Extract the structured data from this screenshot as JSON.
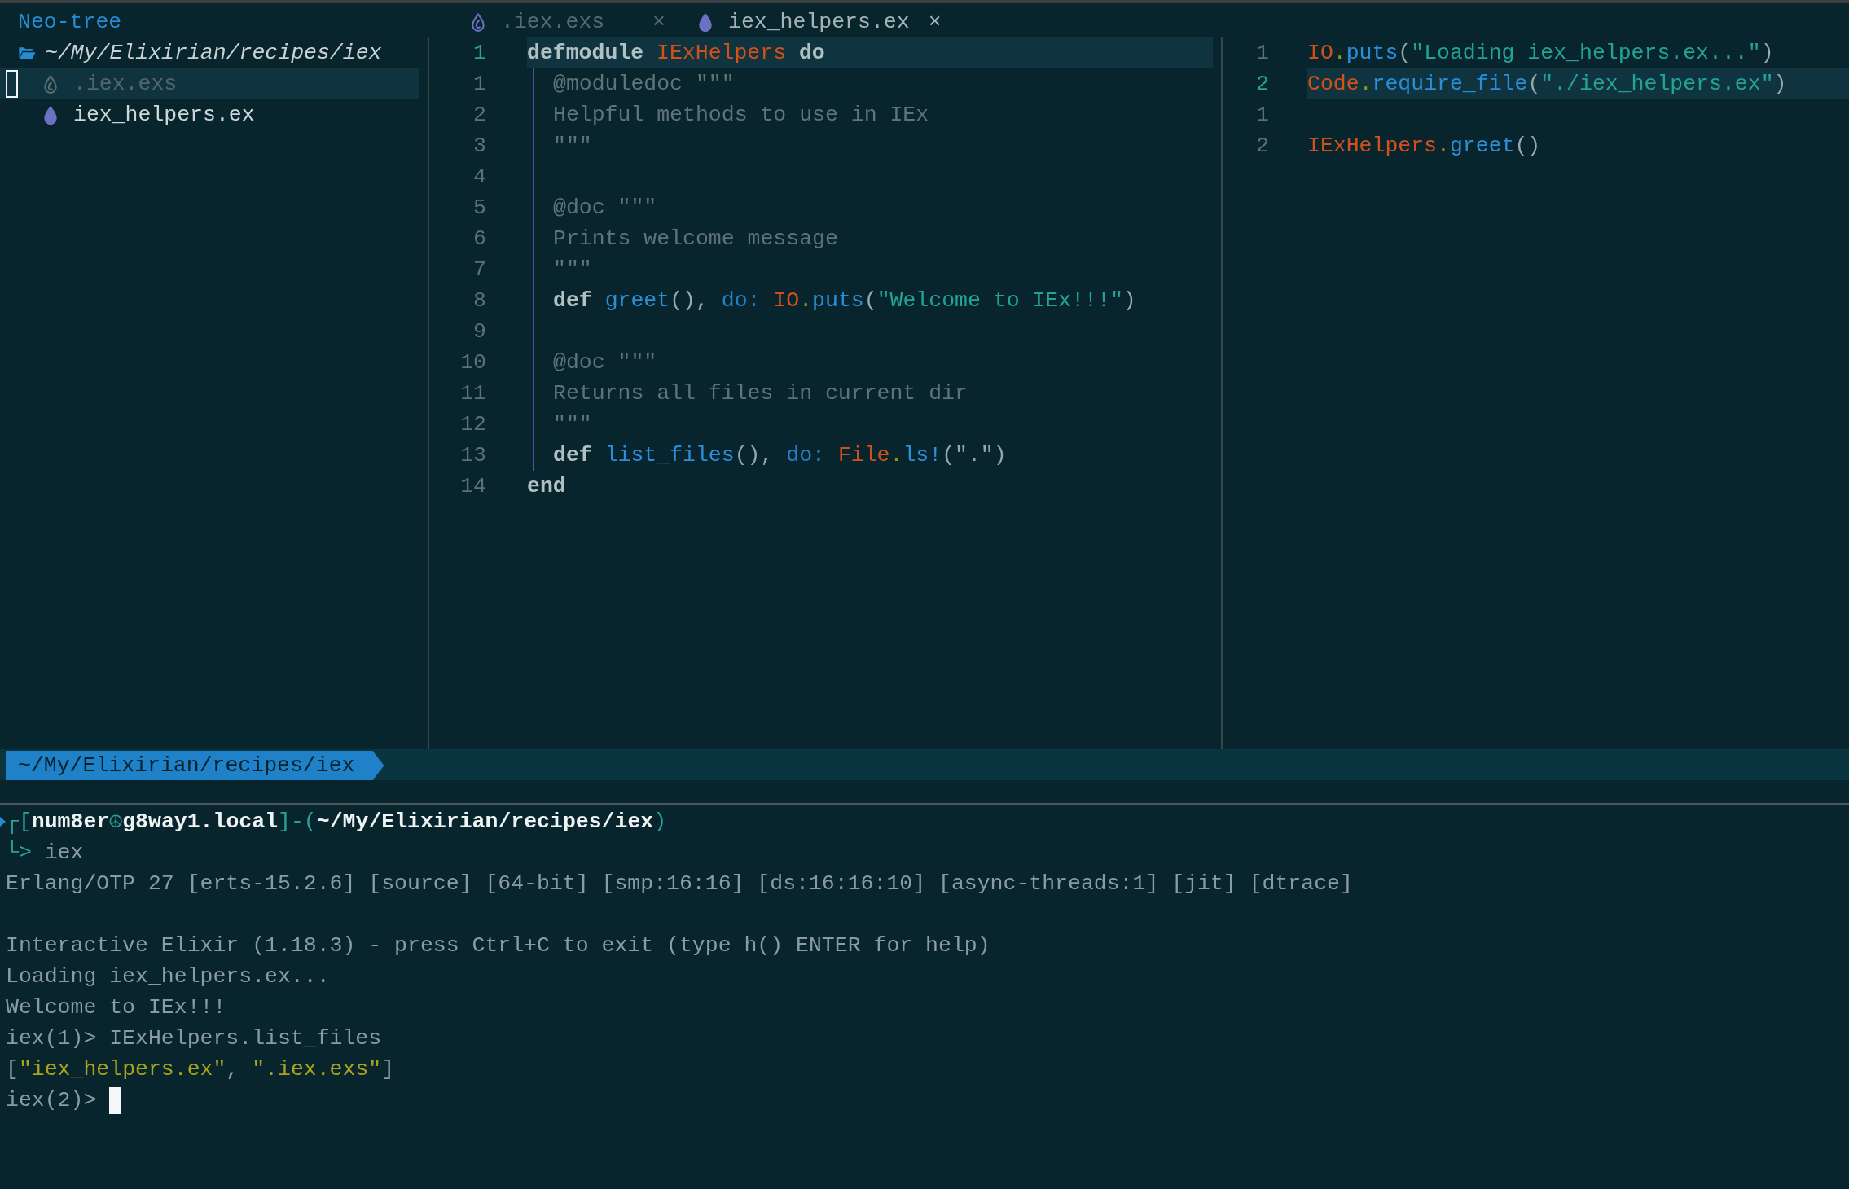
{
  "sidebar": {
    "title": "Neo-tree",
    "root": {
      "label": "~/My/Elixirian/recipes/iex",
      "expanded": true,
      "children": [
        {
          "label": ".iex.exs",
          "kind": "script",
          "hidden": true,
          "selected": true
        },
        {
          "label": "iex_helpers.ex",
          "kind": "source",
          "hidden": false,
          "selected": false
        }
      ]
    }
  },
  "tabs": [
    {
      "label": ".iex.exs",
      "kind": "script",
      "selected": false,
      "close": "×"
    },
    {
      "label": "iex_helpers.ex",
      "kind": "source",
      "selected": true,
      "close": "×"
    }
  ],
  "editor": {
    "lines": [
      {
        "number": "1",
        "current": true,
        "tokens": [
          {
            "text": "defmodule ",
            "kind": "keyword"
          },
          {
            "text": "IExHelpers",
            "kind": "module"
          },
          {
            "text": " do",
            "kind": "keyword"
          }
        ],
        "children": [
          {
            "number": "1",
            "current": false,
            "tokens": [
              {
                "text": "@moduledoc \"\"\"",
                "kind": "doc"
              }
            ]
          },
          {
            "number": "2",
            "current": false,
            "tokens": [
              {
                "text": "Helpful methods to use in IEx",
                "kind": "doc"
              }
            ]
          },
          {
            "number": "3",
            "current": false,
            "tokens": [
              {
                "text": "\"\"\"",
                "kind": "doc"
              }
            ]
          },
          {
            "number": "4",
            "current": false
          },
          {
            "number": "5",
            "current": false,
            "tokens": [
              {
                "text": "@doc \"\"\"",
                "kind": "doc"
              }
            ]
          },
          {
            "number": "6",
            "current": false,
            "tokens": [
              {
                "text": "Prints welcome message",
                "kind": "doc"
              }
            ]
          },
          {
            "number": "7",
            "current": false,
            "tokens": [
              {
                "text": "\"\"\"",
                "kind": "doc"
              }
            ]
          },
          {
            "number": "8",
            "current": false,
            "tokens": [
              {
                "text": "def ",
                "kind": "keyword"
              },
              {
                "text": "greet",
                "kind": "function"
              },
              {
                "text": "(), ",
                "kind": "punct"
              },
              {
                "text": "do: ",
                "kind": "atom"
              },
              {
                "text": "IO",
                "kind": "module"
              },
              {
                "text": ".",
                "kind": "dot"
              },
              {
                "text": "puts",
                "kind": "function"
              },
              {
                "text": "(",
                "kind": "punct"
              },
              {
                "text": "\"Welcome to IEx!!!\"",
                "kind": "string"
              },
              {
                "text": ")",
                "kind": "punct"
              }
            ]
          },
          {
            "number": "9",
            "current": false
          },
          {
            "number": "10",
            "current": false,
            "tokens": [
              {
                "text": "@doc \"\"\"",
                "kind": "doc"
              }
            ]
          },
          {
            "number": "11",
            "current": false,
            "tokens": [
              {
                "text": "Returns all files in current dir",
                "kind": "doc"
              }
            ]
          },
          {
            "number": "12",
            "current": false,
            "tokens": [
              {
                "text": "\"\"\"",
                "kind": "doc"
              }
            ]
          },
          {
            "number": "13",
            "current": false,
            "tokens": [
              {
                "text": "def ",
                "kind": "keyword"
              },
              {
                "text": "list_files",
                "kind": "function"
              },
              {
                "text": "(), ",
                "kind": "punct"
              },
              {
                "text": "do: ",
                "kind": "atom"
              },
              {
                "text": "File",
                "kind": "module"
              },
              {
                "text": ".",
                "kind": "dot"
              },
              {
                "text": "ls!",
                "kind": "function"
              },
              {
                "text": "(\".\")",
                "kind": "punct"
              }
            ]
          }
        ]
      },
      {
        "number": "14",
        "current": false,
        "tokens": [
          {
            "text": "end",
            "kind": "keyword"
          }
        ]
      }
    ]
  },
  "split": {
    "lines": [
      {
        "number": "1",
        "current": false,
        "tokens": [
          {
            "text": "IO",
            "kind": "module"
          },
          {
            "text": ".",
            "kind": "dot"
          },
          {
            "text": "puts",
            "kind": "function"
          },
          {
            "text": "(",
            "kind": "punct"
          },
          {
            "text": "\"Loading iex_helpers.ex...\"",
            "kind": "string"
          },
          {
            "text": ")",
            "kind": "punct"
          }
        ]
      },
      {
        "number": "2",
        "current": true,
        "tokens": [
          {
            "text": "Code",
            "kind": "module"
          },
          {
            "text": ".",
            "kind": "dot"
          },
          {
            "text": "require_file",
            "kind": "function"
          },
          {
            "text": "(",
            "kind": "punct"
          },
          {
            "text": "\"./iex_helpers.ex\"",
            "kind": "string"
          },
          {
            "text": ")",
            "kind": "punct"
          }
        ]
      },
      {
        "number": "1",
        "current": false
      },
      {
        "number": "2",
        "current": false,
        "tokens": [
          {
            "text": "IExHelpers",
            "kind": "module"
          },
          {
            "text": ".",
            "kind": "dot"
          },
          {
            "text": "greet",
            "kind": "function"
          },
          {
            "text": "()",
            "kind": "punct"
          }
        ]
      }
    ]
  },
  "status_line": {
    "path": "~/My/Elixirian/recipes/iex"
  },
  "terminal": {
    "prompt": [
      {
        "text": "┌[",
        "kind": "frame"
      },
      {
        "text": "num8er",
        "kind": "value"
      },
      {
        "text": "☮",
        "kind": "frame"
      },
      {
        "text": "g8way1.local",
        "kind": "value"
      },
      {
        "text": "]-(",
        "kind": "frame"
      },
      {
        "text": "~/My/Elixirian/recipes/iex",
        "kind": "value"
      },
      {
        "text": ")",
        "kind": "frame"
      }
    ],
    "command": {
      "arrow": "└>",
      "text": "iex"
    },
    "lines": [
      {
        "kind": "output",
        "text": "Erlang/OTP 27 [erts-15.2.6] [source] [64-bit] [smp:16:16] [ds:16:16:10] [async-threads:1] [jit] [dtrace]"
      },
      {
        "kind": "blank"
      },
      {
        "kind": "output",
        "text": "Interactive Elixir (1.18.3) - press Ctrl+C to exit (type h() ENTER for help)"
      },
      {
        "kind": "output",
        "text": "Loading iex_helpers.ex..."
      },
      {
        "kind": "output",
        "text": "Welcome to IEx!!!"
      },
      {
        "kind": "output",
        "text": "iex(1)> IExHelpers.list_files"
      },
      {
        "kind": "result",
        "tokens": [
          {
            "text": "[",
            "kind": "punct"
          },
          {
            "text": "\"iex_helpers.ex\"",
            "kind": "string"
          },
          {
            "text": ", ",
            "kind": "punct"
          },
          {
            "text": "\".iex.exs\"",
            "kind": "string"
          },
          {
            "text": "]",
            "kind": "punct"
          }
        ]
      },
      {
        "kind": "input",
        "text": "iex(2)>",
        "cursor": true
      }
    ]
  }
}
